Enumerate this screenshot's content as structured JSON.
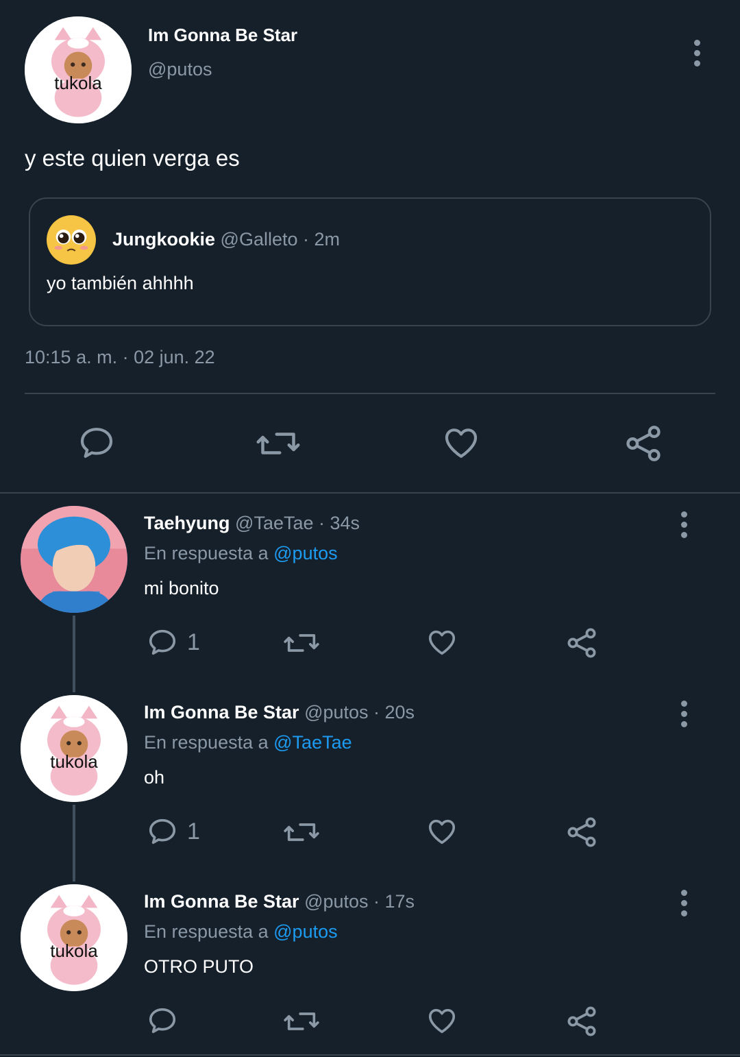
{
  "main_tweet": {
    "display_name": "Im Gonna Be Star",
    "handle": "@putos",
    "avatar_text": "tukola",
    "text": "y este quien verga es",
    "timestamp": "10:15 a. m. · 02 jun. 22",
    "quoted": {
      "display_name": "Jungkookie",
      "handle_time": "@Galleto · 2m",
      "text": "yo también ahhhh"
    }
  },
  "replies": [
    {
      "display_name": "Taehyung",
      "meta": "@TaeTae · 34s",
      "reply_prefix": "En respuesta a",
      "reply_to": "@putos",
      "text": "mi bonito",
      "reply_count": "1"
    },
    {
      "display_name": "Im Gonna Be Star",
      "meta": "@putos · 20s",
      "reply_prefix": "En respuesta a",
      "reply_to": "@TaeTae",
      "text": "oh",
      "avatar_text": "tukola",
      "reply_count": "1"
    },
    {
      "display_name": "Im Gonna Be Star",
      "meta": "@putos · 17s",
      "reply_prefix": "En respuesta a",
      "reply_to": "@putos",
      "text": "OTRO PUTO",
      "avatar_text": "tukola",
      "reply_count": ""
    }
  ],
  "icons": {
    "reply": "comment-icon",
    "retweet": "retweet-icon",
    "like": "heart-icon",
    "share": "share-icon",
    "more": "more-vertical-icon"
  },
  "colors": {
    "background": "#15202b",
    "muted": "#8b98a5",
    "link": "#1d9bf0",
    "divider": "#38444d"
  }
}
